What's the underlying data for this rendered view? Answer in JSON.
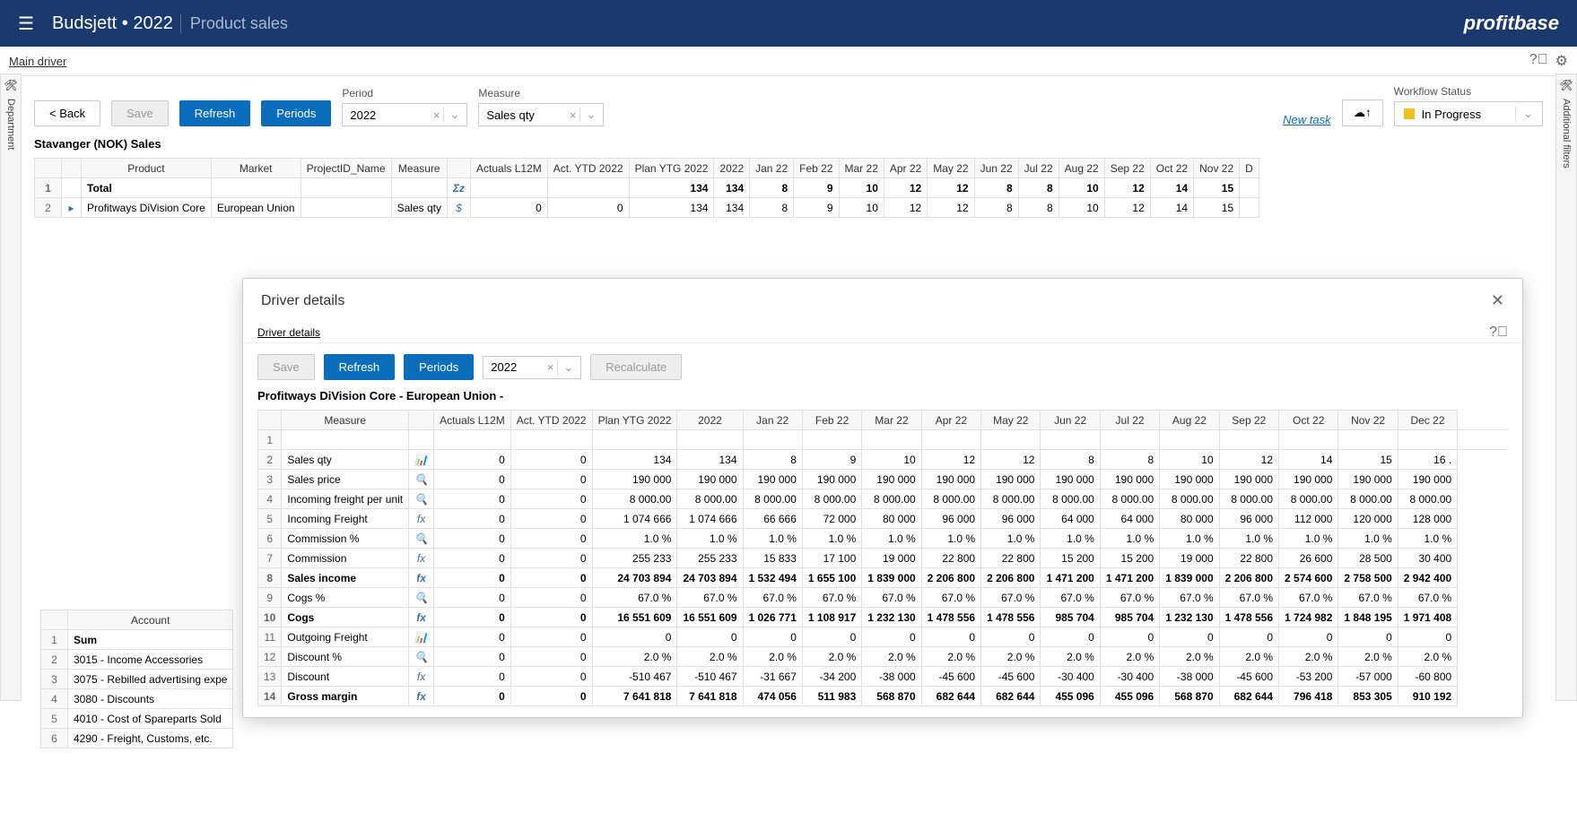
{
  "header": {
    "title": "Budsjett • 2022",
    "subtitle": "Product sales",
    "logo": "profitbase"
  },
  "tabs": {
    "main": "Main driver"
  },
  "rails": {
    "left": "Department",
    "right": "Additional filters"
  },
  "toolbar": {
    "back": "< Back",
    "save": "Save",
    "refresh": "Refresh",
    "periods": "Periods",
    "period_label": "Period",
    "period_value": "2022",
    "measure_label": "Measure",
    "measure_value": "Sales qty",
    "new_task": "New task",
    "workflow_label": "Workflow Status",
    "workflow_value": "In Progress"
  },
  "section": "Stavanger (NOK)  Sales",
  "main_table": {
    "headers": [
      "",
      "",
      "Product",
      "Market",
      "ProjectID_Name",
      "Measure",
      "",
      "Actuals L12M",
      "Act. YTD 2022",
      "Plan YTG 2022",
      "2022",
      "Jan 22",
      "Feb 22",
      "Mar 22",
      "Apr 22",
      "May 22",
      "Jun 22",
      "Jul 22",
      "Aug 22",
      "Sep 22",
      "Oct 22",
      "Nov 22",
      "D"
    ],
    "rows": [
      {
        "n": "1",
        "product": "Total",
        "market": "",
        "proj": "",
        "measure": "",
        "icon": "Σz",
        "l12m": "",
        "ytd": "",
        "plan": "134",
        "y2022": "134",
        "m": [
          "8",
          "9",
          "10",
          "12",
          "12",
          "8",
          "8",
          "10",
          "12",
          "14",
          "15"
        ]
      },
      {
        "n": "2",
        "product": "Profitways DiVision Core",
        "market": "European Union",
        "proj": "",
        "measure": "Sales qty",
        "icon": "$",
        "l12m": "0",
        "ytd": "0",
        "plan": "134",
        "y2022": "134",
        "m": [
          "8",
          "9",
          "10",
          "12",
          "12",
          "8",
          "8",
          "10",
          "12",
          "14",
          "15"
        ]
      }
    ]
  },
  "bottom_table": {
    "header": "Account",
    "rows": [
      {
        "n": "1",
        "t": "Sum",
        "b": true
      },
      {
        "n": "2",
        "t": "3015 - Income Accessories"
      },
      {
        "n": "3",
        "t": "3075 - Rebilled advertising expe"
      },
      {
        "n": "4",
        "t": "3080 - Discounts"
      },
      {
        "n": "5",
        "t": "4010 - Cost of Spareparts Sold"
      },
      {
        "n": "6",
        "t": "4290 - Freight, Customs, etc."
      }
    ]
  },
  "modal": {
    "title": "Driver details",
    "tab": "Driver details",
    "save": "Save",
    "refresh": "Refresh",
    "periods": "Periods",
    "year": "2022",
    "recalc": "Recalculate",
    "subtitle": "Profitways DiVision Core - European Union -",
    "headers": [
      "",
      "Measure",
      "",
      "Actuals L12M",
      "Act. YTD 2022",
      "Plan YTG 2022",
      "2022",
      "Jan 22",
      "Feb 22",
      "Mar 22",
      "Apr 22",
      "May 22",
      "Jun 22",
      "Jul 22",
      "Aug 22",
      "Sep 22",
      "Oct 22",
      "Nov 22",
      "Dec 22"
    ],
    "rows": [
      {
        "n": "1",
        "cells": [
          "",
          "",
          "",
          "",
          "",
          "",
          "",
          "",
          "",
          "",
          "",
          "",
          "",
          "",
          "",
          "",
          "",
          ""
        ]
      },
      {
        "n": "2",
        "m": "Sales qty",
        "i": "📊",
        "cells": [
          "0",
          "0",
          "134",
          "134",
          "8",
          "9",
          "10",
          "12",
          "12",
          "8",
          "8",
          "10",
          "12",
          "14",
          "15",
          "16 ."
        ]
      },
      {
        "n": "3",
        "m": "Sales price",
        "i": "🔍",
        "cells": [
          "0",
          "0",
          "190 000",
          "190 000",
          "190 000",
          "190 000",
          "190 000",
          "190 000",
          "190 000",
          "190 000",
          "190 000",
          "190 000",
          "190 000",
          "190 000",
          "190 000",
          "190 000"
        ]
      },
      {
        "n": "4",
        "m": "Incoming freight per unit",
        "i": "🔍",
        "cells": [
          "0",
          "0",
          "8 000.00",
          "8 000.00",
          "8 000.00",
          "8 000.00",
          "8 000.00",
          "8 000.00",
          "8 000.00",
          "8 000.00",
          "8 000.00",
          "8 000.00",
          "8 000.00",
          "8 000.00",
          "8 000.00",
          "8 000.00"
        ]
      },
      {
        "n": "5",
        "m": "Incoming Freight",
        "i": "fx",
        "cells": [
          "0",
          "0",
          "1 074 666",
          "1 074 666",
          "66 666",
          "72 000",
          "80 000",
          "96 000",
          "96 000",
          "64 000",
          "64 000",
          "80 000",
          "96 000",
          "112 000",
          "120 000",
          "128 000"
        ]
      },
      {
        "n": "6",
        "m": "Commission %",
        "i": "🔍",
        "cells": [
          "0",
          "0",
          "1.0 %",
          "1.0 %",
          "1.0 %",
          "1.0 %",
          "1.0 %",
          "1.0 %",
          "1.0 %",
          "1.0 %",
          "1.0 %",
          "1.0 %",
          "1.0 %",
          "1.0 %",
          "1.0 %",
          "1.0 %"
        ]
      },
      {
        "n": "7",
        "m": "Commission",
        "i": "fx",
        "cells": [
          "0",
          "0",
          "255 233",
          "255 233",
          "15 833",
          "17 100",
          "19 000",
          "22 800",
          "22 800",
          "15 200",
          "15 200",
          "19 000",
          "22 800",
          "26 600",
          "28 500",
          "30 400"
        ]
      },
      {
        "n": "8",
        "m": "Sales income",
        "i": "fx",
        "b": true,
        "cells": [
          "0",
          "0",
          "24 703 894",
          "24 703 894",
          "1 532 494",
          "1 655 100",
          "1 839 000",
          "2 206 800",
          "2 206 800",
          "1 471 200",
          "1 471 200",
          "1 839 000",
          "2 206 800",
          "2 574 600",
          "2 758 500",
          "2 942 400"
        ]
      },
      {
        "n": "9",
        "m": "Cogs %",
        "i": "🔍",
        "cells": [
          "0",
          "0",
          "67.0 %",
          "67.0 %",
          "67.0 %",
          "67.0 %",
          "67.0 %",
          "67.0 %",
          "67.0 %",
          "67.0 %",
          "67.0 %",
          "67.0 %",
          "67.0 %",
          "67.0 %",
          "67.0 %",
          "67.0 %"
        ]
      },
      {
        "n": "10",
        "m": "Cogs",
        "i": "fx",
        "b": true,
        "cells": [
          "0",
          "0",
          "16 551 609",
          "16 551 609",
          "1 026 771",
          "1 108 917",
          "1 232 130",
          "1 478 556",
          "1 478 556",
          "985 704",
          "985 704",
          "1 232 130",
          "1 478 556",
          "1 724 982",
          "1 848 195",
          "1 971 408"
        ]
      },
      {
        "n": "11",
        "m": "Outgoing Freight",
        "i": "📊",
        "cells": [
          "0",
          "0",
          "0",
          "0",
          "0",
          "0",
          "0",
          "0",
          "0",
          "0",
          "0",
          "0",
          "0",
          "0",
          "0",
          "0"
        ]
      },
      {
        "n": "12",
        "m": "Discount %",
        "i": "🔍",
        "cells": [
          "0",
          "0",
          "2.0 %",
          "2.0 %",
          "2.0 %",
          "2.0 %",
          "2.0 %",
          "2.0 %",
          "2.0 %",
          "2.0 %",
          "2.0 %",
          "2.0 %",
          "2.0 %",
          "2.0 %",
          "2.0 %",
          "2.0 %"
        ]
      },
      {
        "n": "13",
        "m": "Discount",
        "i": "fx",
        "cells": [
          "0",
          "0",
          "-510 467",
          "-510 467",
          "-31 667",
          "-34 200",
          "-38 000",
          "-45 600",
          "-45 600",
          "-30 400",
          "-30 400",
          "-38 000",
          "-45 600",
          "-53 200",
          "-57 000",
          "-60 800"
        ]
      },
      {
        "n": "14",
        "m": "Gross margin",
        "i": "fx",
        "b": true,
        "cells": [
          "0",
          "0",
          "7 641 818",
          "7 641 818",
          "474 056",
          "511 983",
          "568 870",
          "682 644",
          "682 644",
          "455 096",
          "455 096",
          "568 870",
          "682 644",
          "796 418",
          "853 305",
          "910 192"
        ]
      }
    ]
  }
}
